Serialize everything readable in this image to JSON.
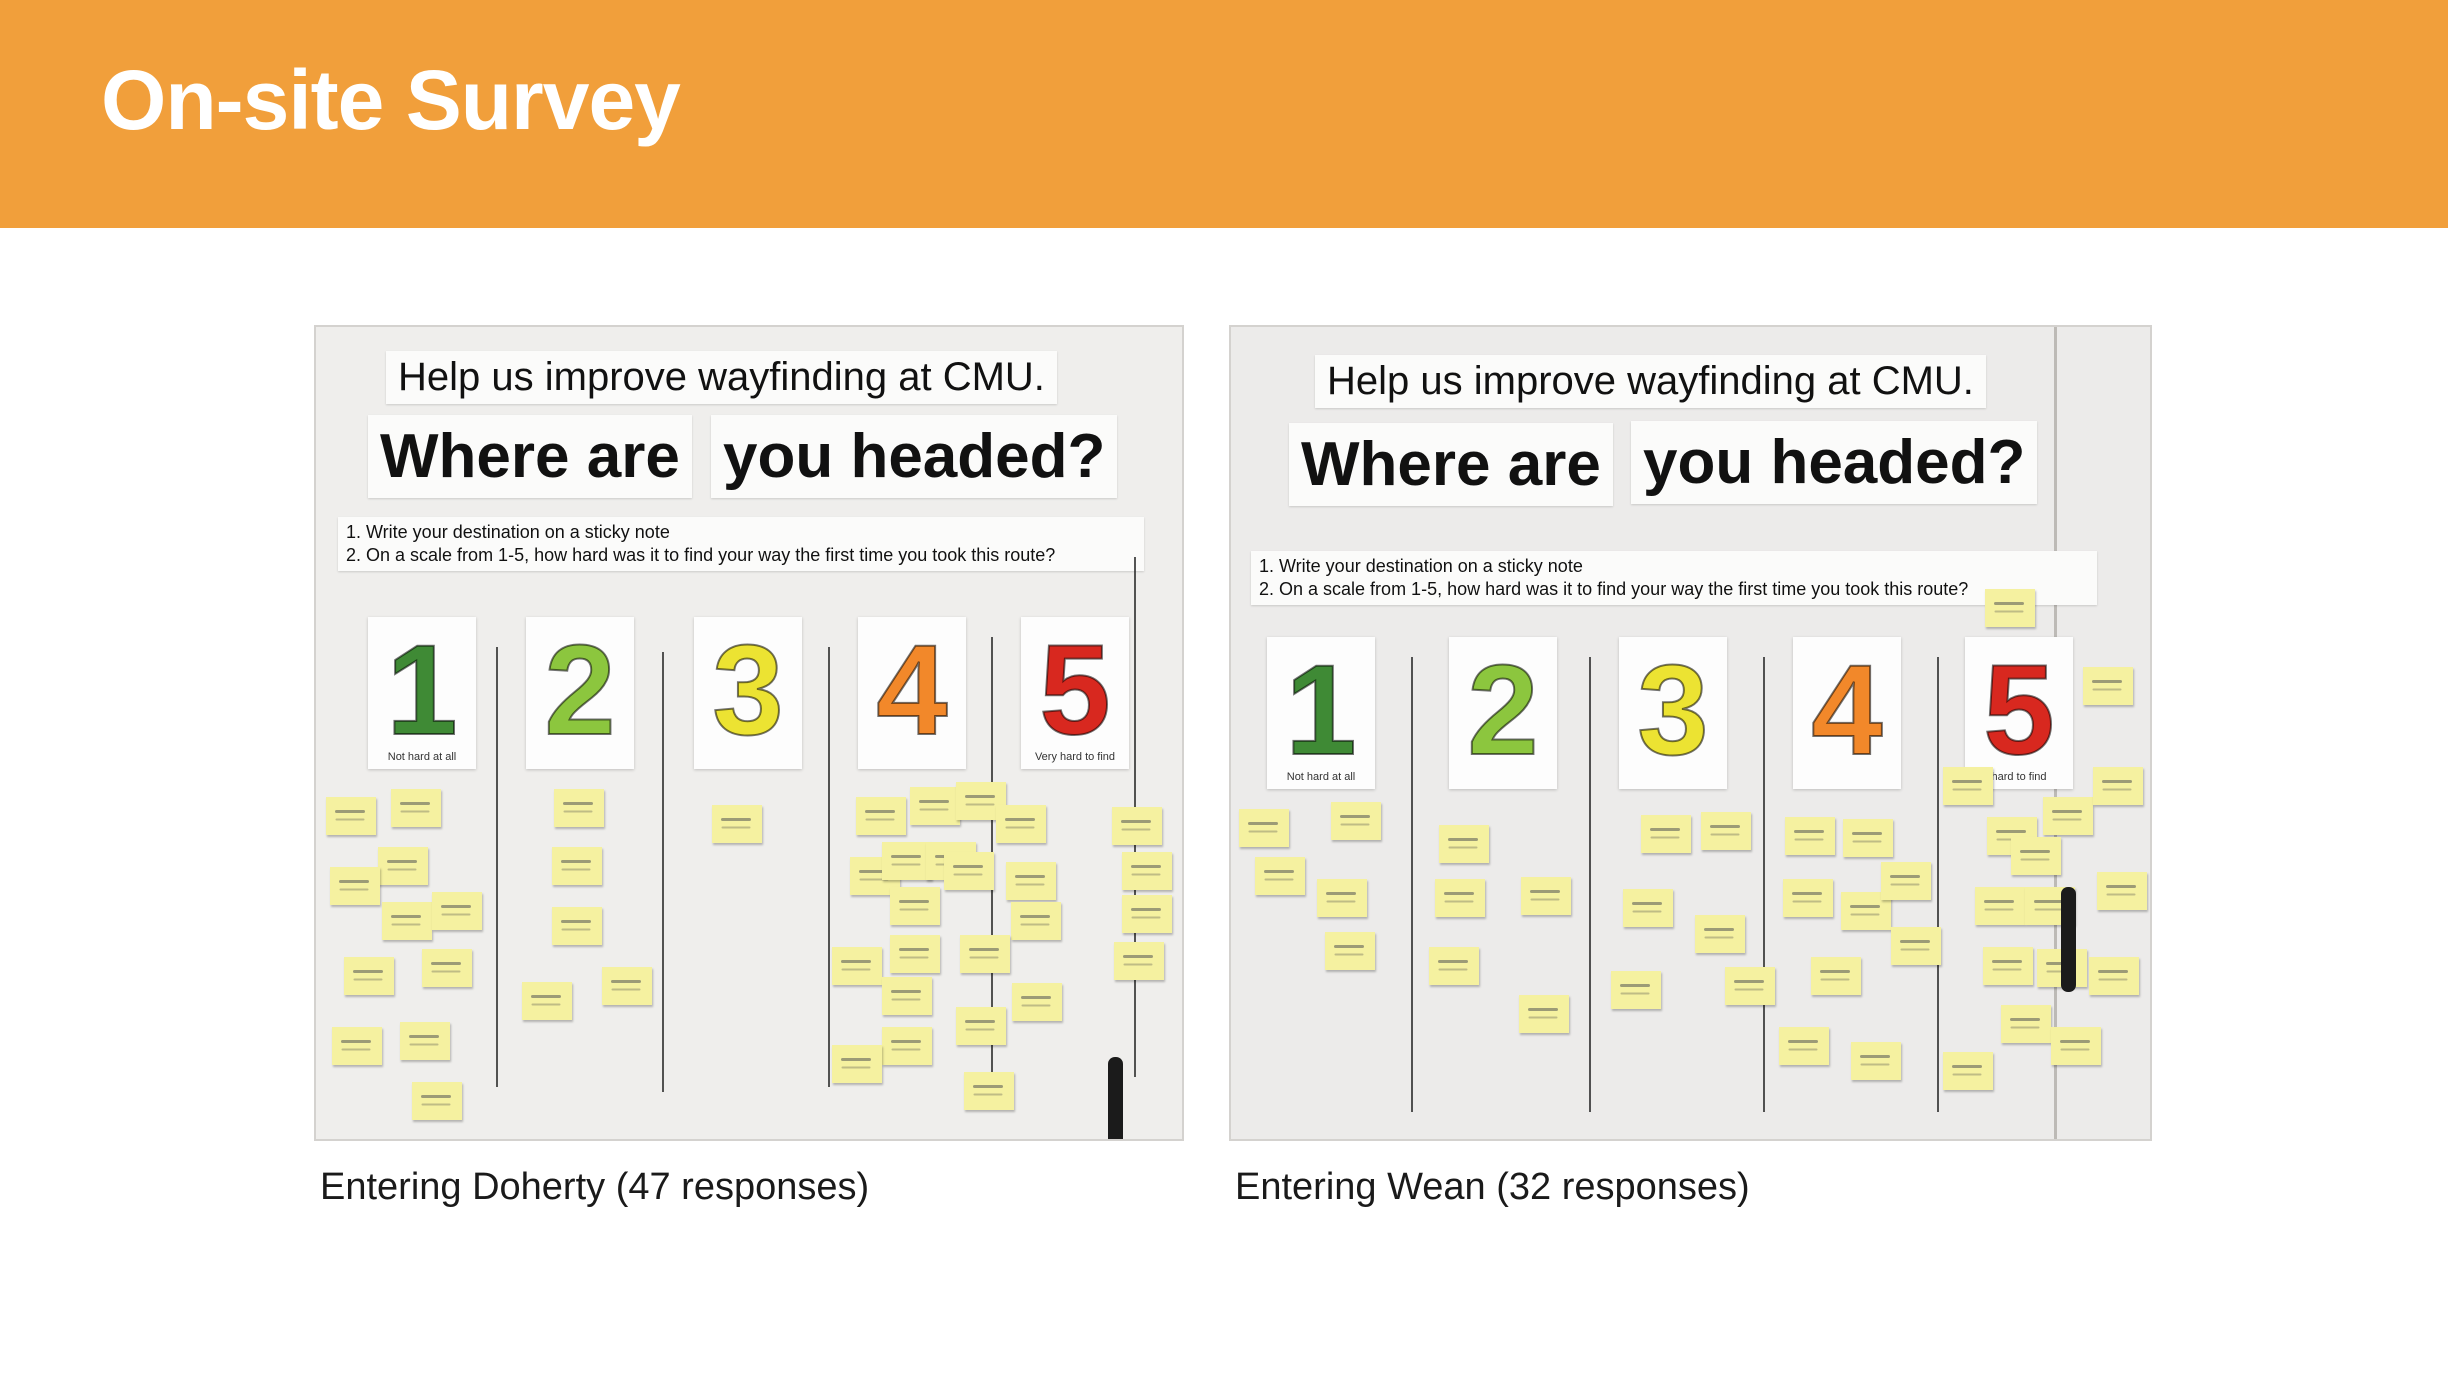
{
  "header": {
    "title": "On-site Survey",
    "background_color": "#f19f3b",
    "text_color": "#ffffff"
  },
  "photos": [
    {
      "caption": "Entering Doherty (47 responses)",
      "poster": {
        "subtitle": "Help us improve wayfinding at CMU.",
        "heading_part1": "Where are",
        "heading_part2": "you headed?",
        "instruction_1": "1. Write your destination on a sticky note",
        "instruction_2": "2. On a scale from 1-5, how hard was it to find your way the first time you took this route?",
        "scale_min_label": "Not hard at all",
        "scale_max_label": "Very hard to find"
      }
    },
    {
      "caption": "Entering Wean (32 responses)",
      "poster": {
        "subtitle": "Help us improve wayfinding at CMU.",
        "heading_part1": "Where are",
        "heading_part2": "you headed?",
        "instruction_1": "1. Write your destination on a sticky note",
        "instruction_2": "2. On a scale from 1-5, how hard was it to find your way the first time you took this route?",
        "scale_min_label": "Not hard at all",
        "scale_max_label": "hard to find"
      }
    }
  ],
  "scale": [
    {
      "label": "1",
      "color": "#3f8a35"
    },
    {
      "label": "2",
      "color": "#8cc63e"
    },
    {
      "label": "3",
      "color": "#ece332"
    },
    {
      "label": "4",
      "color": "#f2882a"
    },
    {
      "label": "5",
      "color": "#d8281f"
    }
  ]
}
